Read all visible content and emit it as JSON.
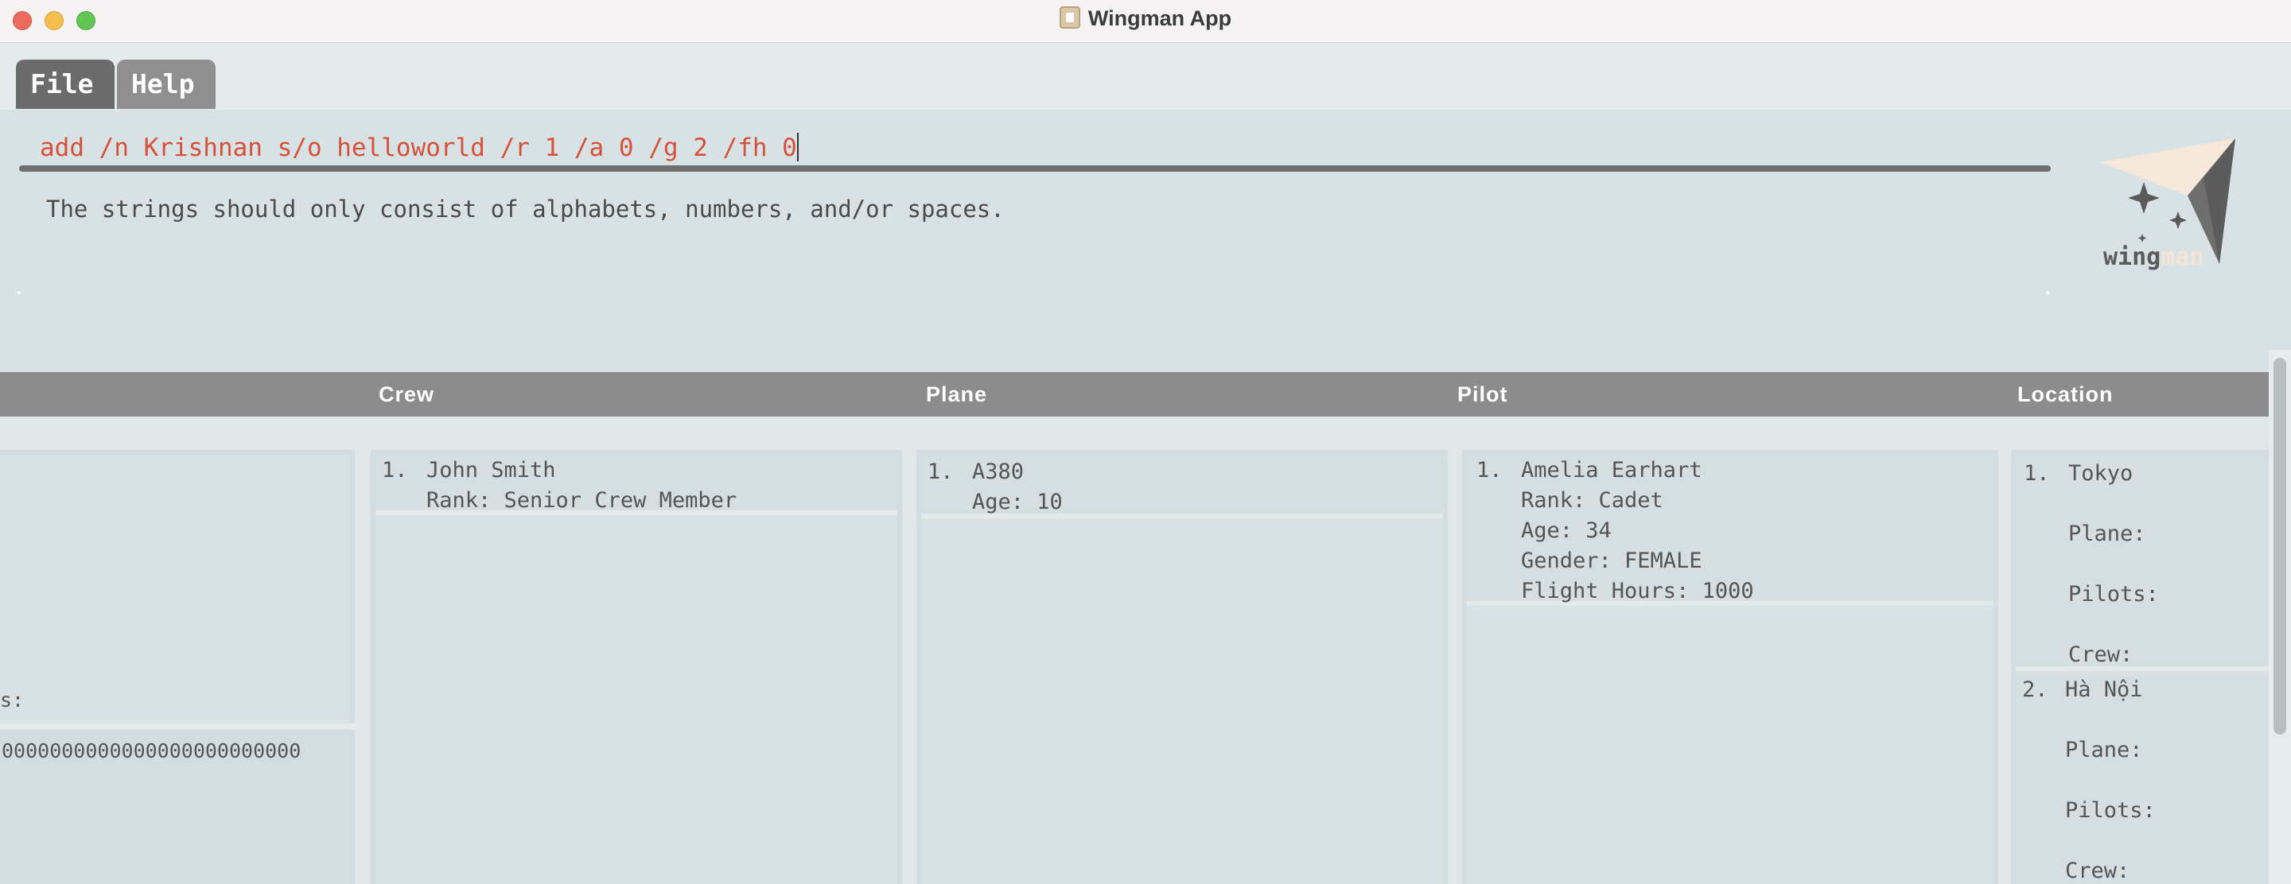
{
  "window": {
    "title": "Wingman App"
  },
  "menu": {
    "file": "File",
    "help": "Help"
  },
  "command": {
    "value": "add /n Krishnan s/o helloworld /r 1 /a 0 /g 2 /fh 0",
    "result": "The strings should only consist of alphabets, numbers, and/or spaces."
  },
  "logo": {
    "text_main": "wing",
    "text_accent": "man"
  },
  "columns": {
    "crew": "Crew",
    "plane": "Plane",
    "pilot": "Pilot",
    "location": "Location"
  },
  "left_panel": {
    "partial_label": "s:",
    "partial_value": "0000000000000000000000000"
  },
  "crew": [
    {
      "index": "1.",
      "name": "John Smith",
      "rank": "Rank: Senior Crew Member"
    }
  ],
  "planes": [
    {
      "index": "1.",
      "name": "A380",
      "age": "Age: 10"
    }
  ],
  "pilots": [
    {
      "index": "1.",
      "name": "Amelia Earhart",
      "rank": "Rank: Cadet",
      "age": "Age: 34",
      "gender": "Gender: FEMALE",
      "flight_hours": "Flight Hours: 1000"
    }
  ],
  "locations": [
    {
      "index": "1.",
      "name": "Tokyo",
      "plane": "Plane:",
      "pilots": "Pilots:",
      "crew": "Crew:"
    },
    {
      "index": "2.",
      "name": "Hà Nội",
      "plane": "Plane:",
      "pilots": "Pilots:",
      "crew": "Crew:"
    }
  ],
  "colors": {
    "command_text": "#d6513a",
    "header_bar": "#8c8c8c",
    "menu_file": "#6b6b6b",
    "menu_help": "#8f8f8f",
    "logo_accent": "#f3e6d6"
  }
}
